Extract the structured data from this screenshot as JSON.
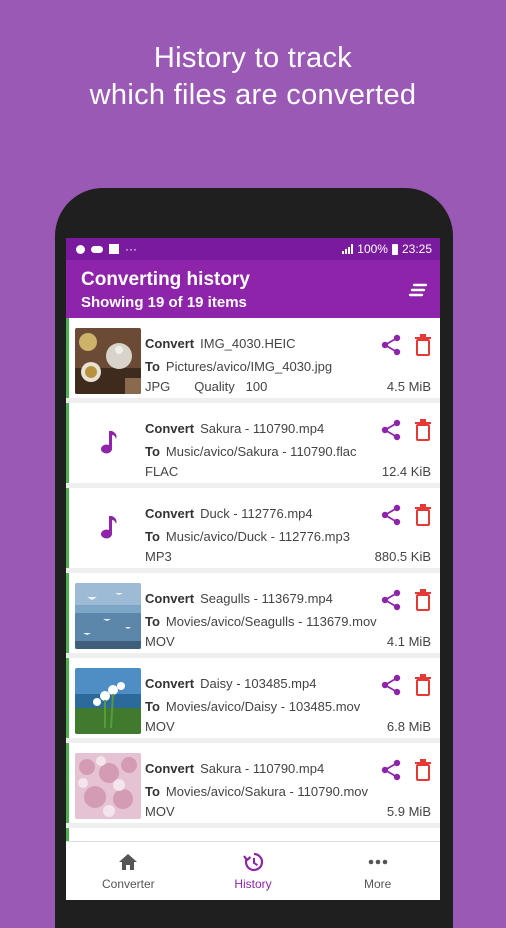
{
  "promo": {
    "line1": "History to track",
    "line2": "which files are converted"
  },
  "statusbar": {
    "dots": "···",
    "battery": "100%",
    "time": "23:25"
  },
  "appbar": {
    "title": "Converting history",
    "subtitle": "Showing 19 of 19 items"
  },
  "labels": {
    "convert": "Convert",
    "to": "To",
    "quality": "Quality"
  },
  "items": [
    {
      "kind": "image",
      "thumb": "tea",
      "source": "IMG_4030.HEIC",
      "dest": "Pictures/avico/IMG_4030.jpg",
      "format": "JPG",
      "quality": "100",
      "size": "4.5 MiB"
    },
    {
      "kind": "audio",
      "source": "Sakura - 110790.mp4",
      "dest": "Music/avico/Sakura - 110790.flac",
      "format": "FLAC",
      "size": "12.4 KiB"
    },
    {
      "kind": "audio",
      "source": "Duck - 112776.mp4",
      "dest": "Music/avico/Duck - 112776.mp3",
      "format": "MP3",
      "size": "880.5 KiB"
    },
    {
      "kind": "video",
      "thumb": "seagulls",
      "source": "Seagulls - 113679.mp4",
      "dest": "Movies/avico/Seagulls - 113679.mov",
      "format": "MOV",
      "size": "4.1 MiB"
    },
    {
      "kind": "video",
      "thumb": "daisy",
      "source": "Daisy - 103485.mp4",
      "dest": "Movies/avico/Daisy - 103485.mov",
      "format": "MOV",
      "size": "6.8 MiB"
    },
    {
      "kind": "video",
      "thumb": "sakura",
      "source": "Sakura - 110790.mp4",
      "dest": "Movies/avico/Sakura - 110790.mov",
      "format": "MOV",
      "size": "5.9 MiB"
    }
  ],
  "nav": [
    {
      "label": "Converter",
      "icon": "home-icon",
      "active": false
    },
    {
      "label": "History",
      "icon": "history-icon",
      "active": true
    },
    {
      "label": "More",
      "icon": "more-icon",
      "active": false
    }
  ],
  "colors": {
    "accent": "#8e24aa",
    "background": "#9b59b6",
    "delete": "#e53935",
    "indicator": "#4caf50"
  }
}
